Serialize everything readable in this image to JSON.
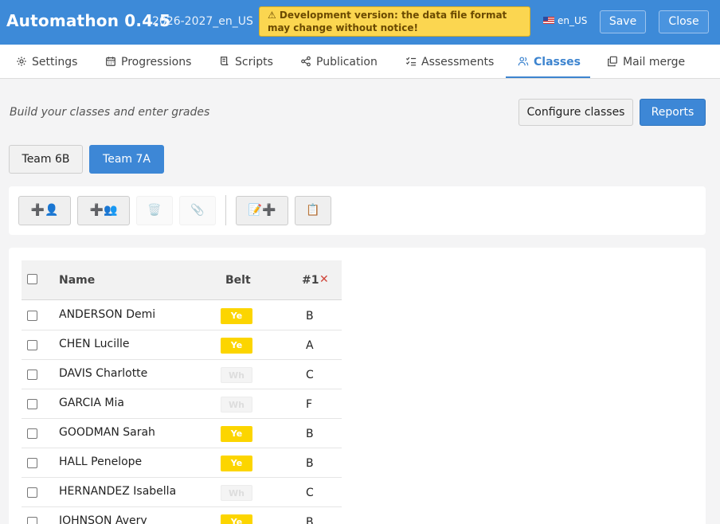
{
  "header": {
    "app_title": "Automathon 0.4.5",
    "version_tag": "2026-2027_en_US",
    "warning_text": "⚠ Development version: the data file format may change without notice!",
    "locale_label": "en_US",
    "save_label": "Save",
    "close_label": "Close"
  },
  "tabs": [
    {
      "label": "Settings",
      "icon": "gear-icon",
      "active": false
    },
    {
      "label": "Progressions",
      "icon": "calendar-icon",
      "active": false
    },
    {
      "label": "Scripts",
      "icon": "script-icon",
      "active": false
    },
    {
      "label": "Publication",
      "icon": "share-icon",
      "active": false
    },
    {
      "label": "Assessments",
      "icon": "checklist-icon",
      "active": false
    },
    {
      "label": "Classes",
      "icon": "users-icon",
      "active": true
    },
    {
      "label": "Mail merge",
      "icon": "copy-icon",
      "active": false
    }
  ],
  "page": {
    "hint": "Build your classes and enter grades",
    "configure_label": "Configure classes",
    "reports_label": "Reports"
  },
  "teams": [
    {
      "label": "Team 6B",
      "active": false
    },
    {
      "label": "Team 7A",
      "active": true
    }
  ],
  "toolbar": {
    "add_student_icon": "➕👤",
    "add_students_icon": "➕👥",
    "delete_icon": "🗑️",
    "attach_icon": "📎",
    "add_assessment_icon": "📝➕",
    "clipboard_icon": "📋"
  },
  "table": {
    "headers": {
      "name": "Name",
      "belt": "Belt",
      "assessment": "#1",
      "remove": "✕"
    },
    "rows": [
      {
        "name": "ANDERSON Demi",
        "belt": "Ye",
        "grade": "B"
      },
      {
        "name": "CHEN Lucille",
        "belt": "Ye",
        "grade": "A"
      },
      {
        "name": "DAVIS Charlotte",
        "belt": "Wh",
        "grade": "C"
      },
      {
        "name": "GARCIA Mia",
        "belt": "Wh",
        "grade": "F"
      },
      {
        "name": "GOODMAN Sarah",
        "belt": "Ye",
        "grade": "B"
      },
      {
        "name": "HALL Penelope",
        "belt": "Ye",
        "grade": "B"
      },
      {
        "name": "HERNANDEZ Isabella",
        "belt": "Wh",
        "grade": "C"
      },
      {
        "name": "JOHNSON Avery",
        "belt": "Ye",
        "grade": "B"
      }
    ]
  },
  "colors": {
    "header_bg": "#3d8ad8",
    "accent": "#3d87d6",
    "warning_bg": "#fbd650",
    "belt_yellow": "#fcd500",
    "belt_white": "#f4f4f4"
  }
}
